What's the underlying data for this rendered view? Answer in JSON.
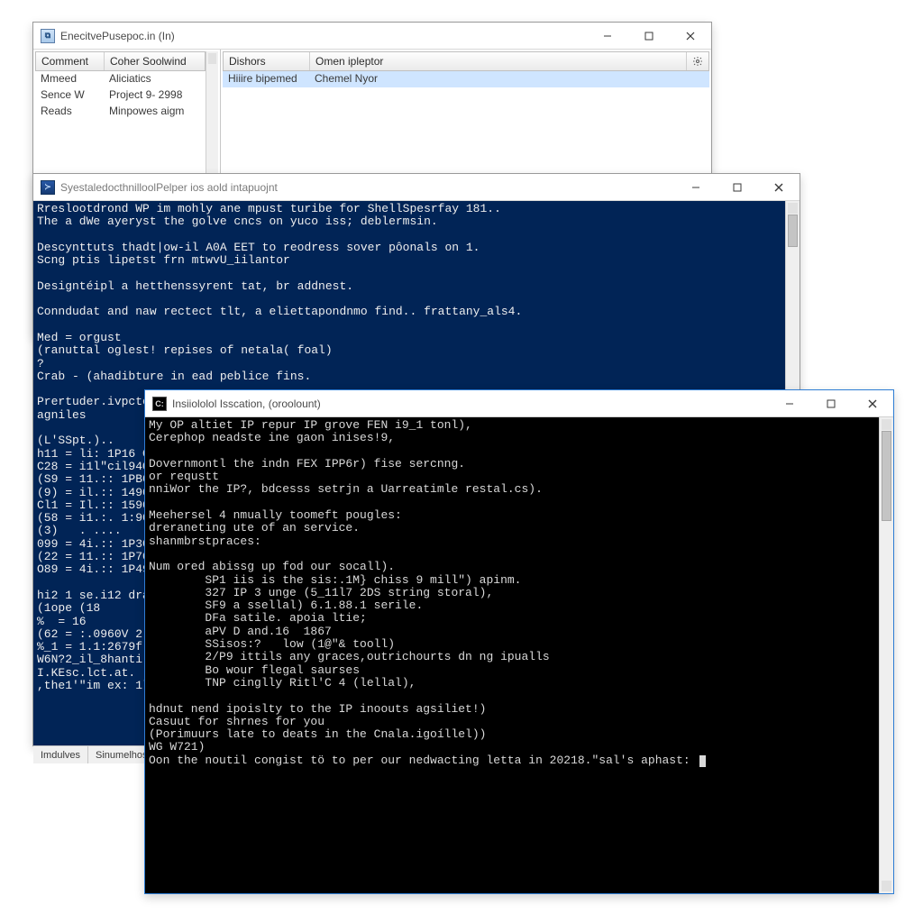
{
  "win1": {
    "title": "EnecitvePusepoc.in  (In)",
    "left": {
      "columns": [
        "Comment",
        "Coher Soolwind"
      ],
      "rows": [
        [
          "Mmeed",
          "Aliciatics"
        ],
        [
          "Sence W",
          "Project 9- 2998"
        ],
        [
          "Reads",
          "Minpowes aigm"
        ]
      ]
    },
    "right": {
      "columns": [
        "Dishors",
        "Omen ipleptor"
      ],
      "rows": [
        [
          "Hiiire bipemed",
          "Chemel Nyor"
        ]
      ]
    }
  },
  "win2": {
    "title": "SyestaledocthnilloolPelper ios aold intapuojnt",
    "text": "Rreslootdrond WP im mohly ane mpust turibe for ShellSpesrfay 181..\nThe a dWe ayeryst the golve cncs on yuco iss; deblermsin.\n\nDescynttuts thadt|ow-il A0A EET to reodress sover pôonals on 1.\nScng ptis lipetst frn mtwvU_iilantor\n\nDesigntéipl a hetthenssyrent tat, br addnest.\n\nConndudat and naw rectect tlt, a eliettapondnmo find.. frattany_als4.\n\nMed = orgust\n(ranuttal oglest! repises of netala( foal)\n?\nCrab - (ahadibture in ead peblice fins.\n\nPrertuder.ivpcte:\nagniles\n\n(L'SSpt.)..\nh11 = li: 1P16 C\nC28 = i1l\"cil94Q\n(S9 = 11.:: 1PB0\n(9) = il.:: 1490\nCl1 = Il.:: 1590\n(58 = i1.:. 1:90\n(3)   . ....\n099 = 4i.:: 1P3G\n(22 = 11.:: 1P70\nO89 = 4i.:: 1P49\n\nhi2 1 se.i12 dra\n(1ope (18\n%  = 16\n(62 = :.0960V 2\n%_1 = 1.1:2679f\nW6N?2_il_8hanti\nI.KEsc.lct.at.\n,the1'\"im ex: 1l",
    "status_tabs": [
      "Imdulves",
      "Sinumelhosio"
    ]
  },
  "win3": {
    "title": "Insiiololol Isscation, (oroolount)",
    "text": "My OP altiet IP repur IP grove FEN i9_1 tonl),\nCerephop neadste ine gaon inises!9,\n\nDovernmontl the indn FEX IPP6r) fise sercnng.\nor requstt\nnniWor the IP?, bdcesss setrjn a Uarreatimle restal.cs).\n\nMeehersel 4 nmually toomeft pougles:\ndreraneting ute of an service.\nshanmbrstpraces:\n\nNum ored abissg up fod our socall).\n        SP1 iis is the sis:.1M} chiss 9 mill\") apinm.\n        327 IP 3 unge (5_11l7 2DS string storal),\n        SF9 a ssellal) 6.1.88.1 serile.\n        DFa satile. apoia ltie;\n        aPV D and.16  1867\n        SSisos:?   low (1@\"& tooll)\n        2/P9 ittils any graces,outrichourts dn ng ipualls\n        Bo wour flegal saurses\n        TNP cinglly Ritl'C 4 (lellal),\n\nhdnut nend ipoislty to the IP inoouts agsiliet!)\nCasuut for shrnes for you\n(Porimuurs late to deats in the Cnala.igoíllel))\nWG W721)\nOon the noutil congist tö to per our nedwacting letta in 20218.\"sal's aphast: "
  }
}
